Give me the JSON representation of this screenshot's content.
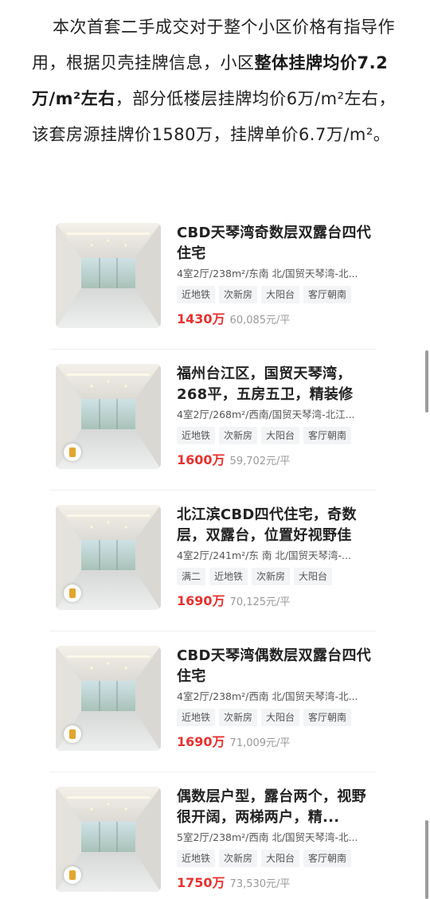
{
  "intro": {
    "part1": "本次首套二手成交对于整个小区价格有指导作用，根据贝壳挂牌信息，小区",
    "bold": "整体挂牌均价7.2万/m²左右",
    "part2": "，部分低楼层挂牌均价6万/m²左右，该套房源挂牌价1580万，挂牌单价6.7万/m²。"
  },
  "listings": [
    {
      "title": "CBD天琴湾奇数层双露台四代住宅",
      "meta": "4室2厅/238m²/东南 北/国贸天琴湾-北...",
      "tags": [
        "近地铁",
        "次新房",
        "大阳台",
        "客厅朝南"
      ],
      "price": "1430万",
      "unit_price": "60,085元/平",
      "photo_icon": "photo-placeholder",
      "has_vr_badge": false
    },
    {
      "title": "福州台江区，国贸天琴湾，268平，五房五卫，精装修",
      "meta": "4室2厅/268m²/西南/国贸天琴湾-北江...",
      "tags": [
        "近地铁",
        "次新房",
        "大阳台",
        "客厅朝南"
      ],
      "price": "1600万",
      "unit_price": "59,702元/平",
      "photo_icon": "photo-placeholder",
      "has_vr_badge": true
    },
    {
      "title": "北江滨CBD四代住宅，奇数层，双露台，位置好视野佳",
      "meta": "4室2厅/241m²/东 南 北/国贸天琴湾-...",
      "tags": [
        "满二",
        "近地铁",
        "次新房",
        "大阳台"
      ],
      "price": "1690万",
      "unit_price": "70,125元/平",
      "photo_icon": "photo-placeholder",
      "has_vr_badge": true
    },
    {
      "title": "CBD天琴湾偶数层双露台四代住宅",
      "meta": "4室2厅/238m²/西南 北/国贸天琴湾-北...",
      "tags": [
        "近地铁",
        "次新房",
        "大阳台",
        "客厅朝南"
      ],
      "price": "1690万",
      "unit_price": "71,009元/平",
      "photo_icon": "photo-placeholder",
      "has_vr_badge": true
    },
    {
      "title": "偶数层户型，露台两个，视野很开阔，两梯两户，精...",
      "meta": "5室2厅/238m²/西南 北/国贸天琴湾-北...",
      "tags": [
        "近地铁",
        "次新房",
        "大阳台",
        "客厅朝南"
      ],
      "price": "1750万",
      "unit_price": "73,530元/平",
      "photo_icon": "photo-placeholder",
      "has_vr_badge": true
    }
  ]
}
